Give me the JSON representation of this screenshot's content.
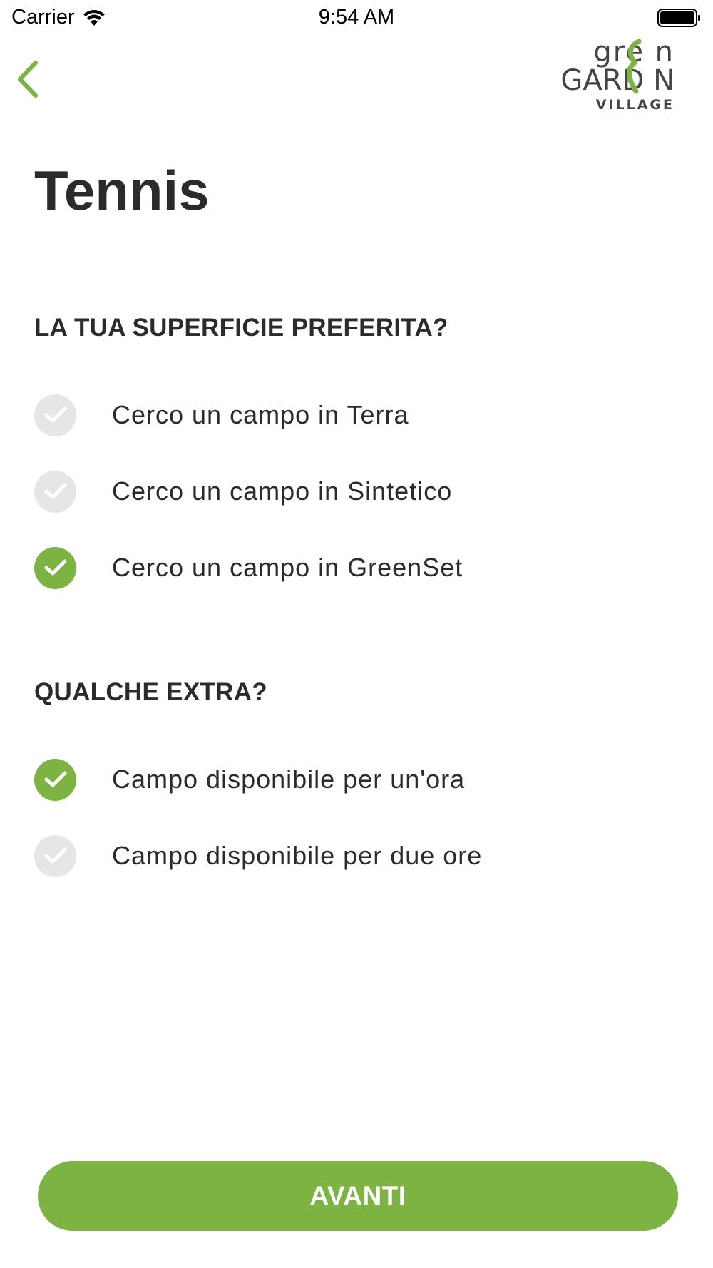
{
  "status_bar": {
    "carrier": "Carrier",
    "time": "9:54 AM"
  },
  "logo": {
    "line1": "gre n",
    "line2": "GARD N",
    "line3": "VILLAGE"
  },
  "page": {
    "title": "Tennis"
  },
  "sections": [
    {
      "title": "LA TUA SUPERFICIE PREFERITA?",
      "options": [
        {
          "label": "Cerco un campo in Terra",
          "checked": false
        },
        {
          "label": "Cerco un campo in Sintetico",
          "checked": false
        },
        {
          "label": "Cerco un campo in GreenSet",
          "checked": true
        }
      ]
    },
    {
      "title": "QUALCHE EXTRA?",
      "options": [
        {
          "label": "Campo disponibile per un'ora",
          "checked": true
        },
        {
          "label": "Campo disponibile per due ore",
          "checked": false
        }
      ]
    }
  ],
  "footer": {
    "button_label": "AVANTI"
  },
  "colors": {
    "accent": "#7cb342",
    "unchecked": "#e6e6e6",
    "text": "#2b2b2b"
  },
  "icons": {
    "back": "chevron-left-icon",
    "wifi": "wifi-icon",
    "battery": "battery-icon",
    "check": "checkmark-icon"
  }
}
